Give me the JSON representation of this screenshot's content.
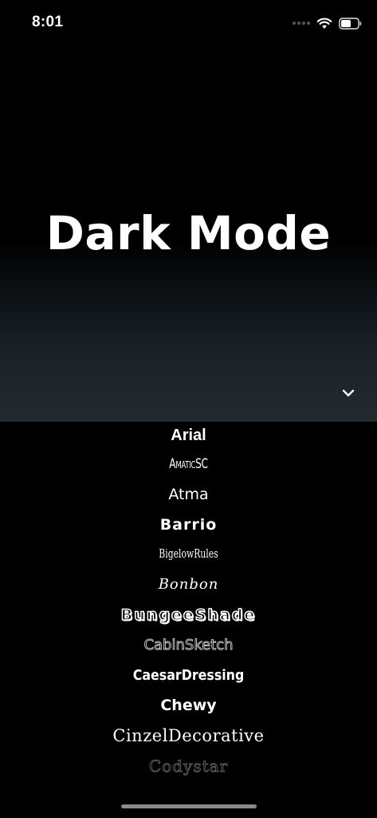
{
  "status_bar": {
    "time": "8:01",
    "icons": [
      "signal-dots-icon",
      "wifi-icon",
      "battery-icon"
    ]
  },
  "hero": {
    "title": "Dark Mode",
    "expand_icon": "chevron-down-icon"
  },
  "font_list": {
    "items": [
      "Arial",
      "AmaticSC",
      "Atma",
      "Barrio",
      "BigelowRules",
      "Bonbon",
      "BungeeShade",
      "CabinSketch",
      "CaesarDressing",
      "Chewy",
      "CinzelDecorative",
      "Codystar"
    ]
  },
  "colors": {
    "background": "#000000",
    "hero_gradient_bottom": "#232b31",
    "text": "#ffffff"
  }
}
